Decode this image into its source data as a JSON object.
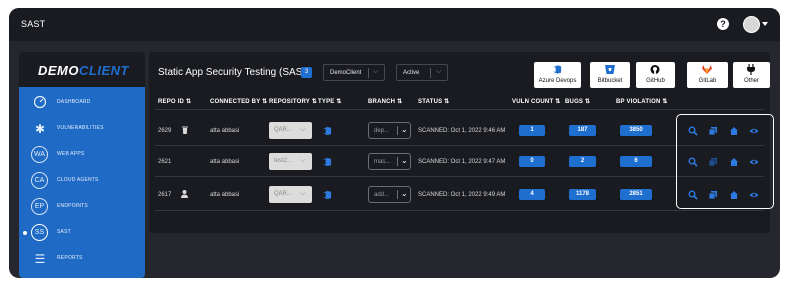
{
  "app": {
    "title": "SAST"
  },
  "header": {
    "help_icon": "question-icon",
    "avatar_icon": "user-avatar-icon"
  },
  "sidebar": {
    "logo_part1": "DEMO",
    "logo_part2": "CLIENT",
    "items": [
      {
        "label": "DASHBOARD",
        "icon": "dashboard-gauge-icon",
        "badge": ""
      },
      {
        "label": "VULNERABILITIES",
        "icon": "bug-icon",
        "badge": ""
      },
      {
        "label": "WEB APPS",
        "icon": "circle-badge-icon",
        "badge": "WA"
      },
      {
        "label": "CLOUD AGENTS",
        "icon": "circle-badge-icon",
        "badge": "CA"
      },
      {
        "label": "ENDPOINTS",
        "icon": "circle-badge-icon",
        "badge": "EP"
      },
      {
        "label": "SAST",
        "icon": "circle-badge-icon",
        "badge": "SS",
        "active": true
      },
      {
        "label": "REPORTS",
        "icon": "list-icon",
        "badge": ""
      }
    ]
  },
  "main": {
    "title": "Static App Security Testing (SAST)",
    "count": "3",
    "filters": [
      {
        "value": "DemoClient"
      },
      {
        "value": "Active"
      }
    ],
    "integrations": [
      {
        "label": "Azure Devops",
        "icon": "azure-devops-icon",
        "color": "#1f6fd0"
      },
      {
        "label": "Bitbucket",
        "icon": "bitbucket-icon",
        "color": "#1f6fd0"
      },
      {
        "label": "GitHub",
        "icon": "github-icon",
        "color": "#111111"
      },
      {
        "label": "GitLab",
        "icon": "gitlab-icon",
        "color": "#e2432a"
      },
      {
        "label": "Other",
        "icon": "plug-icon",
        "color": "#111111"
      }
    ],
    "columns": [
      "REPO ID",
      "CONNECTED BY",
      "REPOSITORY",
      "TYPE",
      "BRANCH",
      "STATUS",
      "VULN COUNT",
      "BUGS",
      "BP VIOLATION"
    ],
    "rows": [
      {
        "repo_id": "2629",
        "repo_icon": "trash-icon",
        "connected_by": "atta abbasi",
        "repository": "QAR...",
        "branch": "dep...",
        "status": "SCANNED: Oct 1, 2022 9:46 AM",
        "vuln": "1",
        "bugs": "187",
        "bp": "3850",
        "type_icon": "azure-devops-icon"
      },
      {
        "repo_id": "2621",
        "repo_icon": "",
        "connected_by": "atta abbasi",
        "repository": "test2...",
        "branch": "mas...",
        "status": "SCANNED: Oct 1, 2022 9:47 AM",
        "vuln": "0",
        "bugs": "2",
        "bp": "6",
        "type_icon": "azure-devops-icon"
      },
      {
        "repo_id": "2617",
        "repo_icon": "user-icon",
        "connected_by": "atta abbasi",
        "repository": "QAR...",
        "branch": "add...",
        "status": "SCANNED: Oct 1, 2022 9:49 AM",
        "vuln": "4",
        "bugs": "1178",
        "bp": "2851",
        "type_icon": "azure-devops-icon"
      }
    ],
    "actions": [
      "search-icon",
      "copy-icon",
      "home-icon",
      "eye-icon"
    ]
  },
  "colors": {
    "accent": "#1f6fd0",
    "sidebar_nav": "#1e6ac4",
    "background": "#26272e",
    "panel": "#1a1b20"
  }
}
